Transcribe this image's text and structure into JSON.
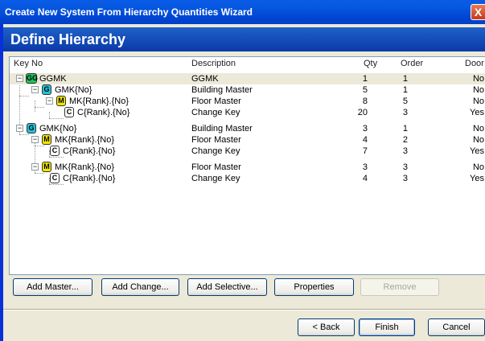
{
  "window": {
    "title": "Create New System From Hierarchy Quantities Wizard",
    "close_glyph": "X"
  },
  "page": {
    "title": "Define Hierarchy"
  },
  "columns": {
    "key": "Key No",
    "description": "Description",
    "qty": "Qty",
    "order": "Order",
    "door": "Door"
  },
  "rows": [
    {
      "badge": "GG",
      "badge_color": "#22c55e",
      "key": "GGMK",
      "description": "GGMK",
      "qty": "1",
      "order": "1",
      "door": "No",
      "toggle": "−"
    },
    {
      "badge": "G",
      "badge_color": "#22c3d8",
      "key": "GMK{No}",
      "description": "Building Master",
      "qty": "5",
      "order": "1",
      "door": "No",
      "toggle": "−"
    },
    {
      "badge": "M",
      "badge_color": "#f2e600",
      "key": "MK{Rank}.{No}",
      "description": "Floor Master",
      "qty": "8",
      "order": "5",
      "door": "No",
      "toggle": "−"
    },
    {
      "badge": "C",
      "badge_color": "#ffffff",
      "key": "C{Rank}.{No}",
      "description": "Change Key",
      "qty": "20",
      "order": "3",
      "door": "Yes",
      "toggle": ""
    },
    {
      "badge": "G",
      "badge_color": "#22c3d8",
      "key": "GMK{No}",
      "description": "Building Master",
      "qty": "3",
      "order": "1",
      "door": "No",
      "toggle": "−"
    },
    {
      "badge": "M",
      "badge_color": "#f2e600",
      "key": "MK{Rank}.{No}",
      "description": "Floor Master",
      "qty": "4",
      "order": "2",
      "door": "No",
      "toggle": "−"
    },
    {
      "badge": "C",
      "badge_color": "#ffffff",
      "key": "C{Rank}.{No}",
      "description": "Change Key",
      "qty": "7",
      "order": "3",
      "door": "Yes",
      "toggle": ""
    },
    {
      "badge": "M",
      "badge_color": "#f2e600",
      "key": "MK{Rank}.{No}",
      "description": "Floor Master",
      "qty": "3",
      "order": "3",
      "door": "No",
      "toggle": "−"
    },
    {
      "badge": "C",
      "badge_color": "#ffffff",
      "key": "C{Rank}.{No}",
      "description": "Change Key",
      "qty": "4",
      "order": "3",
      "door": "Yes",
      "toggle": ""
    }
  ],
  "buttons": {
    "add_master": "Add Master...",
    "add_change": "Add Change...",
    "add_selective": "Add Selective...",
    "properties": "Properties",
    "remove": "Remove",
    "back": "< Back",
    "finish": "Finish",
    "cancel": "Cancel"
  }
}
